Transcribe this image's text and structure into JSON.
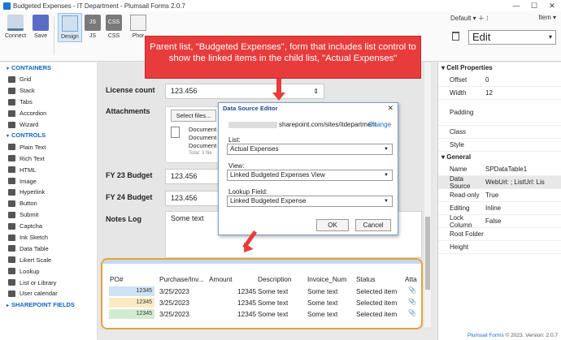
{
  "window": {
    "title": "Budgeted Expenses - IT Department - Plumsail Forms 2.0.7"
  },
  "ribbon": {
    "connect": "Connect",
    "save": "Save",
    "design": "Design",
    "js": "JS",
    "css": "CSS",
    "phone": "Phor",
    "layout_value": "Default",
    "item_value": "Item",
    "edit_value": "Edit"
  },
  "left_panel": {
    "containers_title": "CONTAINERS",
    "containers": [
      "Grid",
      "Stack",
      "Tabs",
      "Accordion",
      "Wizard"
    ],
    "controls_title": "CONTROLS",
    "controls": [
      "Plain Text",
      "Rich Text",
      "HTML",
      "Image",
      "Hyperlink",
      "Button",
      "Submit",
      "Captcha",
      "Ink Sketch",
      "Data Table",
      "Likert Scale",
      "Lookup",
      "List or Library",
      "User calendar"
    ],
    "sp_fields_title": "SHAREPOINT FIELDS"
  },
  "form": {
    "bill_label": "bill",
    "license_label": "License count",
    "license_value": "123.456",
    "attachments_label": "Attachments",
    "select_files": "Select files...",
    "documents": [
      "Document",
      "Document",
      "Document"
    ],
    "total_text": "Total: 3 file",
    "fy23_label": "FY 23 Budget",
    "fy23_value": "123.456",
    "fy24_label": "FY 24 Budget",
    "fy24_value": "123.456",
    "notes_label": "Notes Log",
    "notes_value": "Some text"
  },
  "callout": {
    "text": "Parent list, \"Budgeted Expenses\", form that includes list control to show the linked items in the child list, \"Actual Expenses\""
  },
  "dialog": {
    "title": "Data Source Editor",
    "url": "sharepoint.com/sites/itdepartment",
    "change_link": "Change",
    "list_label": "List:",
    "list_value": "Actual Expenses",
    "view_label": "View:",
    "view_value": "Linked Budgeted Expenses View",
    "lookup_label": "Lookup Field:",
    "lookup_value": "Linked Budgeted Expense",
    "ok": "OK",
    "cancel": "Cancel"
  },
  "table": {
    "headers": [
      "PO#",
      "Purchase/Inv...",
      "Amount",
      "Description",
      "Invoice_Num",
      "Status",
      "Atta"
    ],
    "rows": [
      {
        "po": "12345",
        "date": "3/25/2023",
        "amount": "12345",
        "desc": "Some text",
        "inv": "Some text",
        "status": "Selected item",
        "color": "#cfe2f3"
      },
      {
        "po": "12345",
        "date": "3/25/2023",
        "amount": "12345",
        "desc": "Some text",
        "inv": "Some text",
        "status": "Selected item",
        "color": "#fde9c2"
      },
      {
        "po": "12345",
        "date": "3/25/2023",
        "amount": "12345",
        "desc": "Some text",
        "inv": "Some text",
        "status": "Selected item",
        "color": "#d3ecd1"
      }
    ]
  },
  "right_panel": {
    "cell_title": "Cell Properties",
    "cell": [
      {
        "k": "Offset",
        "v": "0"
      },
      {
        "k": "Width",
        "v": "12"
      },
      {
        "k": "Padding",
        "v": ""
      },
      {
        "k": "Class",
        "v": ""
      },
      {
        "k": "Style",
        "v": ""
      }
    ],
    "general_title": "General",
    "general": [
      {
        "k": "Name",
        "v": "SPDataTable1"
      },
      {
        "k": "Data Source",
        "v": "WebUrl: ; ListUrl: Lis"
      },
      {
        "k": "Read-only",
        "v": "True"
      },
      {
        "k": "Editing",
        "v": "Inline"
      },
      {
        "k": "Lock Column",
        "v": "False"
      },
      {
        "k": "Root Folder",
        "v": ""
      },
      {
        "k": "Height",
        "v": ""
      }
    ]
  },
  "footer": {
    "brand": "Plumsail Forms",
    "text": " © 2023. Version: 2.0.7"
  }
}
